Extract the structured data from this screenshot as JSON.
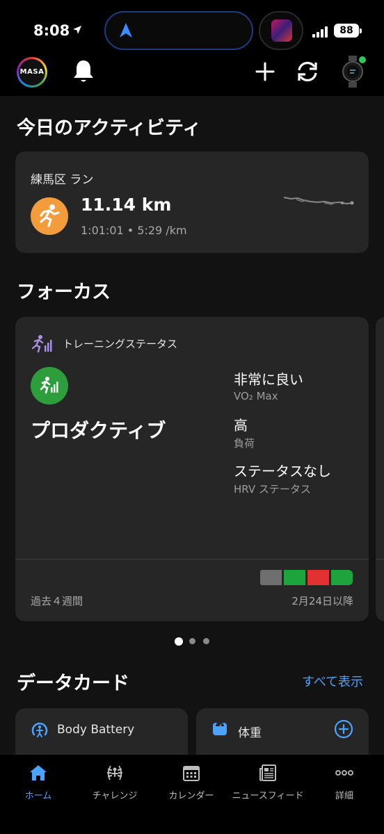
{
  "status_bar": {
    "time": "8:08",
    "battery": "88"
  },
  "header": {
    "avatar_text": "MASA"
  },
  "today": {
    "title": "今日のアクティビティ",
    "activity": {
      "location": "練馬区 ラン",
      "distance": "11.14 km",
      "stats": "1:01:01 • 5:29 /km"
    }
  },
  "focus": {
    "title": "フォーカス",
    "card": {
      "header": "トレーニングステータス",
      "status": "プロダクティブ",
      "metrics": [
        {
          "value": "非常に良い",
          "label": "VO₂ Max"
        },
        {
          "value": "高",
          "label": "負荷"
        },
        {
          "value": "ステータスなし",
          "label": "HRV ステータス"
        }
      ],
      "footer_left": "過去４週間",
      "footer_right": "2月24日以降",
      "history_colors": [
        "#6f6f6f",
        "#1ea43c",
        "#e13131",
        "#1ea43c"
      ]
    },
    "pager": {
      "pages": 3,
      "active": 1
    }
  },
  "data_cards": {
    "title": "データカード",
    "see_all": "すべて表示",
    "cards": [
      {
        "label": "Body Battery",
        "icon": "body-battery-icon"
      },
      {
        "label": "体重",
        "icon": "scale-icon"
      }
    ]
  },
  "tabbar": {
    "tabs": [
      {
        "label": "ホーム",
        "icon": "home-icon",
        "active": true
      },
      {
        "label": "チャレンジ",
        "icon": "laurel-icon",
        "active": false
      },
      {
        "label": "カレンダー",
        "icon": "calendar-icon",
        "active": false
      },
      {
        "label": "ニュースフィード",
        "icon": "newsfeed-icon",
        "active": false
      },
      {
        "label": "詳細",
        "icon": "more-icon",
        "active": false
      }
    ]
  },
  "colors": {
    "accent": "#4aa3ff",
    "run": "#f39c3c",
    "productive": "#2e9e3d",
    "card": "#262626",
    "background": "#121212"
  }
}
